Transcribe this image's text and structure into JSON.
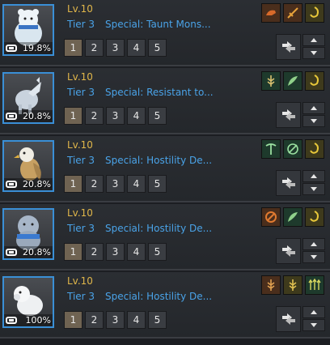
{
  "pets": [
    {
      "level": "Lv.10",
      "tier": "Tier 3",
      "special": "Special: Taunt Mons...",
      "percent": "19.8%",
      "pet_icon": "white-bear-icon",
      "skills": [
        "boar-charge-icon",
        "sword-slash-icon",
        "gold-rune-icon"
      ],
      "pages": [
        "1",
        "2",
        "3",
        "4",
        "5"
      ],
      "active_page": "1"
    },
    {
      "level": "Lv.10",
      "tier": "Tier 3",
      "special": "Special: Resistant to...",
      "percent": "20.8%",
      "pet_icon": "snow-wolf-icon",
      "skills": [
        "wheat-sigil-icon",
        "feather-wing-icon",
        "gold-rune-icon"
      ],
      "pages": [
        "1",
        "2",
        "3",
        "4",
        "5"
      ],
      "active_page": "1"
    },
    {
      "level": "Lv.10",
      "tier": "Tier 3",
      "special": "Special: Hostility De...",
      "percent": "20.8%",
      "pet_icon": "eagle-icon",
      "skills": [
        "pickaxe-icon",
        "crossed-circle-icon",
        "gold-rune-icon"
      ],
      "pages": [
        "1",
        "2",
        "3",
        "4",
        "5"
      ],
      "active_page": "1"
    },
    {
      "level": "Lv.10",
      "tier": "Tier 3",
      "special": "Special: Hostility De...",
      "percent": "20.8%",
      "pet_icon": "armored-lion-icon",
      "skills": [
        "axe-strike-icon",
        "feather-wing-icon",
        "gold-rune-icon"
      ],
      "pages": [
        "1",
        "2",
        "3",
        "4",
        "5"
      ],
      "active_page": "1"
    },
    {
      "level": "Lv.10",
      "tier": "Tier 3",
      "special": "Special: Hostility De...",
      "percent": "100%",
      "pet_icon": "white-dog-icon",
      "skills": [
        "wheat-sigil-icon",
        "wheat-sigil-icon",
        "triple-arrow-icon"
      ],
      "pages": [
        "1",
        "2",
        "3",
        "4",
        "5"
      ],
      "active_page": "1"
    }
  ],
  "colors": {
    "level": "#e0b64a",
    "tier": "#4aa3e8",
    "portrait_border": "#3a8fd6",
    "active_page": "#6f6352"
  }
}
